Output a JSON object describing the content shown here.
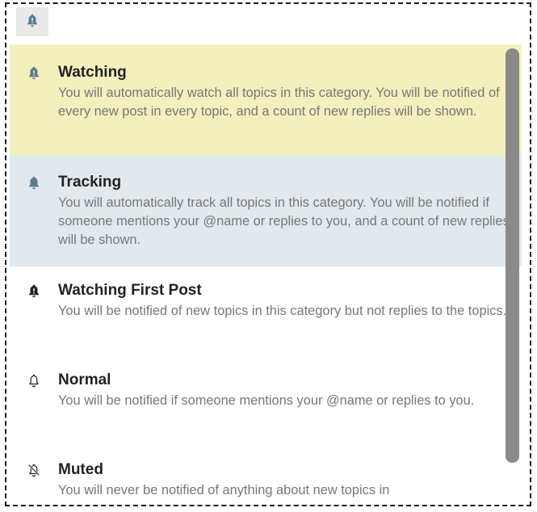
{
  "trigger": {
    "icon": "bell-exclamation-icon",
    "color": "#5d7c8e"
  },
  "menu": {
    "items": [
      {
        "title": "Watching",
        "description": "You will automatically watch all topics in this category. You will be notified of every new post in every topic, and a count of new replies will be shown.",
        "icon": "bell-exclamation-icon",
        "icon_color": "#5d7c8e",
        "state": "selected",
        "background": "#f4f0bd"
      },
      {
        "title": "Tracking",
        "description": "You will automatically track all topics in this category. You will be notified if someone mentions your @name or replies to you, and a count of new replies will be shown.",
        "icon": "bell-icon",
        "icon_color": "#5d7c8e",
        "state": "hover",
        "background": "#e1e9ee"
      },
      {
        "title": "Watching First Post",
        "description": "You will be notified of new topics in this category but not replies to the topics.",
        "icon": "bell-exclamation-icon",
        "icon_color": "#222222"
      },
      {
        "title": "Normal",
        "description": "You will be notified if someone mentions your @name or replies to you.",
        "icon": "bell-outline-icon",
        "icon_color": "#222222"
      },
      {
        "title": "Muted",
        "description": "You will never be notified of anything about new topics in",
        "icon": "bell-slash-icon",
        "icon_color": "#222222"
      }
    ]
  }
}
